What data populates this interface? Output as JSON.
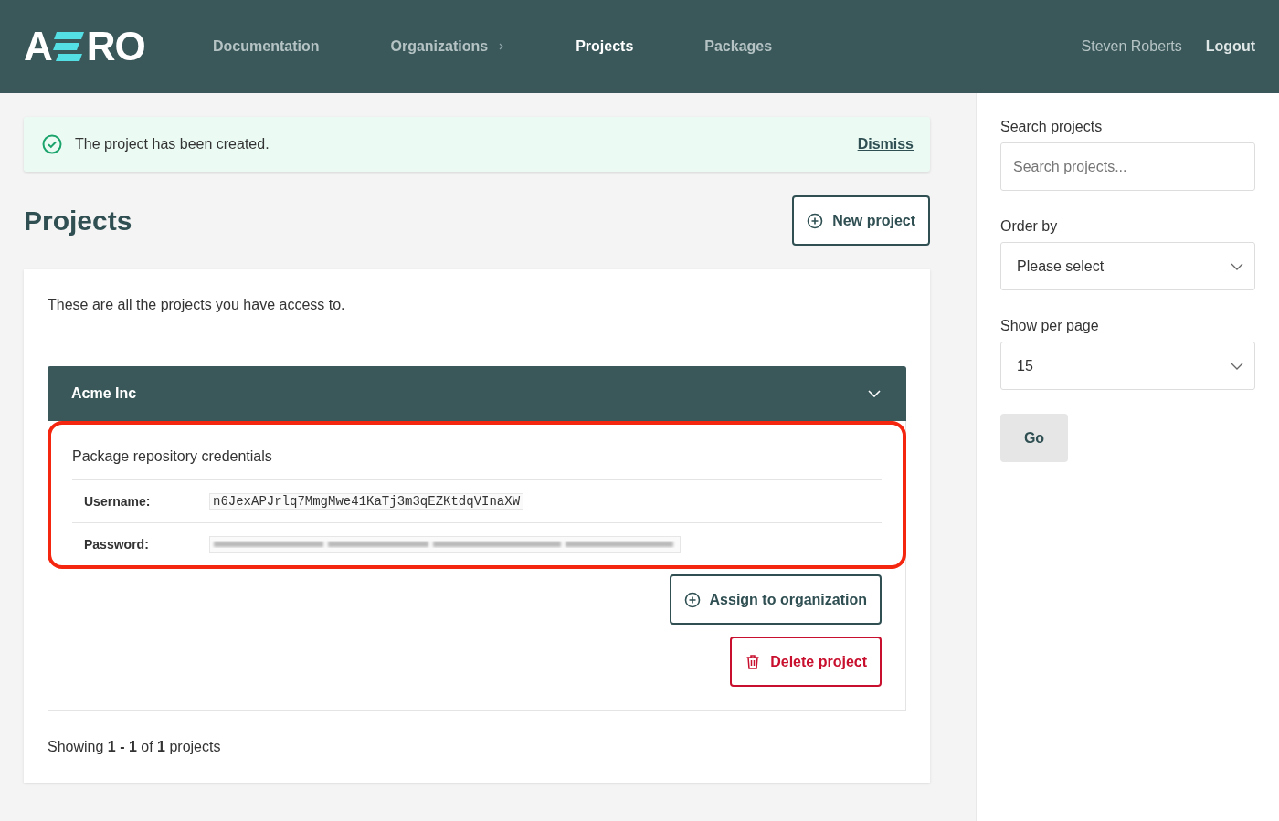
{
  "logo": {
    "before": "A",
    "after": "RO"
  },
  "nav": [
    {
      "label": "Documentation",
      "selected": false,
      "submenu": false
    },
    {
      "label": "Organizations",
      "selected": false,
      "submenu": true
    },
    {
      "label": "Projects",
      "selected": true,
      "submenu": false
    },
    {
      "label": "Packages",
      "selected": false,
      "submenu": false
    }
  ],
  "user": {
    "name": "Steven Roberts",
    "logout": "Logout"
  },
  "alert": {
    "message": "The project has been created.",
    "dismiss": "Dismiss"
  },
  "page_title": "Projects",
  "new_project_button": "New project",
  "intro": "These are all the projects you have access to.",
  "projects": [
    {
      "name": "Acme Inc",
      "expanded": true,
      "highlighted": true,
      "credentials_title": "Package repository credentials",
      "fields": [
        {
          "label": "Username:",
          "value": "n6JexAPJrlq7MmgMwe41KaTj3m3qEZKtdqVInaXW",
          "blurred": false
        },
        {
          "label": "Password:",
          "blurred": true
        }
      ],
      "assign_button": "Assign to organization",
      "delete_button": "Delete project"
    }
  ],
  "pagination": "Showing **1 - 1** of **1** projects",
  "sidebar": {
    "search_label": "Search projects",
    "search_placeholder": "Search projects...",
    "order_label": "Order by",
    "order_value": "Please select",
    "per_page_label": "Show per page",
    "per_page_value": "15",
    "go_button": "Go"
  }
}
